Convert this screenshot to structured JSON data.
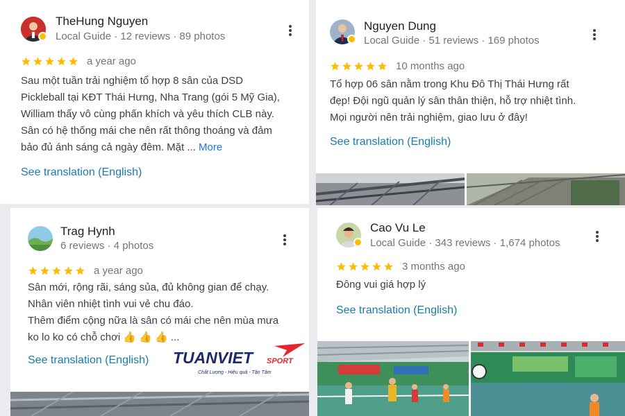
{
  "reviews": [
    {
      "name": "TheHung Nguyen",
      "meta": "Local Guide · 12 reviews · 89 photos",
      "rating": 5,
      "time": "a year ago",
      "text_lines": [
        "Sau một tuần trải nghiệm tổ hợp 8 sân của DSD",
        "Pickleball tại KĐT Thái Hưng, Nha Trang (gói 5 Mỹ Gia),",
        "William thấy vô cùng phấn khích và yêu thích CLB này.",
        "Sân có hệ thống mái che nên rất thông thoáng và đảm",
        "bảo đủ ánh sáng cả ngày đêm. Mặt ..."
      ],
      "more_label": "More",
      "translate_label": "See translation (English)"
    },
    {
      "name": "Nguyen Dung",
      "meta": "Local Guide · 51 reviews · 169 photos",
      "rating": 5,
      "time": "10 months ago",
      "text_lines": [
        "Tổ hợp 06 sân nằm trong Khu Đô Thị Thái Hưng rất",
        "đẹp! Đội ngũ quản lý sân thân thiện, hỗ trợ nhiệt tình.",
        "Mọi người nên trải nghiệm, giao lưu ở đây!"
      ],
      "translate_label": "See translation (English)"
    },
    {
      "name": "Trag Hynh",
      "meta": "6 reviews · 4 photos",
      "rating": 5,
      "time": "a year ago",
      "text_lines": [
        "Sân mới, rộng rãi, sáng sủa, đủ không gian để chạy.",
        "Nhân viên nhiệt tình vui vẻ chu đáo.",
        "Thêm điểm cộng nữa là sân có mái che nên mùa mưa",
        "ko lo ko có chỗ chơi 👍 👍 👍 ..."
      ],
      "translate_label": "See translation (English)"
    },
    {
      "name": "Cao Vu Le",
      "meta": "Local Guide · 343 reviews · 1,674 photos",
      "rating": 5,
      "time": "3 months ago",
      "text_lines": [
        "Đông vui giá hợp lý"
      ],
      "translate_label": "See translation (English)"
    }
  ],
  "watermark": {
    "brand": "TUANVIET",
    "brand_suffix": "SPORT",
    "tagline": "Chất Lượng - Hiệu quả - Tận Tâm"
  },
  "colors": {
    "star": "#fbbc04",
    "link": "#1a7bad",
    "brand_navy": "#1c2a6b",
    "brand_red": "#e3262c"
  },
  "icons": [
    "star-icon",
    "more-vert-icon",
    "local-guide-badge-icon"
  ]
}
